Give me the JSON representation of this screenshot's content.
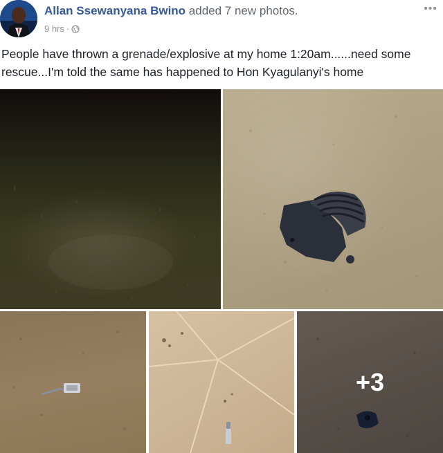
{
  "post": {
    "author": "Allan Ssewanyana Bwino",
    "action": "added 7 new photos.",
    "time": "9 hrs",
    "separator": "·",
    "more": "•••",
    "text": "People have thrown a grenade/explosive at my home 1:20am......need some rescue...I'm told the same has happened to Hon Kyagulanyi's home",
    "privacy_icon": "globe-icon"
  },
  "photos": {
    "extra_count": "+3"
  },
  "colors": {
    "author_link": "#365899",
    "meta_text": "#90949c",
    "body_text": "#1d2129"
  }
}
